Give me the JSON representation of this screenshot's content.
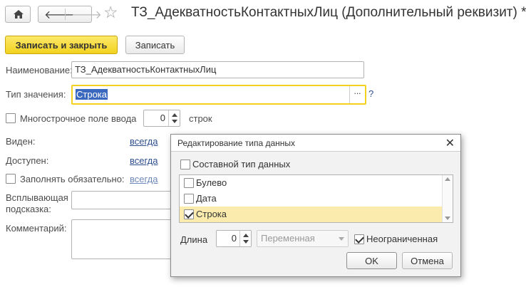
{
  "header": {
    "title": "ТЗ_АдекватностьКонтактныхЛиц (Дополнительный реквизит) *"
  },
  "toolbar": {
    "save_close_label": "Записать и закрыть",
    "save_label": "Записать"
  },
  "form": {
    "name_label": "Наименование:",
    "name_value": "ТЗ_АдекватностьКонтактныхЛиц",
    "type_label": "Тип значения:",
    "type_value": "Строка",
    "type_select_btn": "...",
    "type_help": "?",
    "multiline_label": "Многострочное поле ввода",
    "multiline_value": "0",
    "rows_label": "строк",
    "visible_label": "Виден:",
    "visible_value": "всегда",
    "available_label": "Доступен:",
    "available_value": "всегда",
    "required_label": "Заполнять обязательно:",
    "required_value": "всегда",
    "tooltip_label_line1": "Всплывающая",
    "tooltip_label_line2": "подсказка:",
    "comment_label": "Комментарий:"
  },
  "dialog": {
    "title": "Редактирование типа данных",
    "close": "✕",
    "composite_label": "Составной тип данных",
    "types": [
      {
        "label": "Булево",
        "checked": false,
        "selected": false
      },
      {
        "label": "Дата",
        "checked": false,
        "selected": false
      },
      {
        "label": "Строка",
        "checked": true,
        "selected": true
      }
    ],
    "length_label": "Длина",
    "length_value": "0",
    "variant_value": "Переменная",
    "unlimited_label": "Неограниченная",
    "ok_label": "OK",
    "cancel_label": "Отмена"
  },
  "colors": {
    "primary_button": "#f2d21f",
    "selection_row": "#fbecae",
    "focus_border": "#f2d21f",
    "link": "#2e4e8e"
  }
}
